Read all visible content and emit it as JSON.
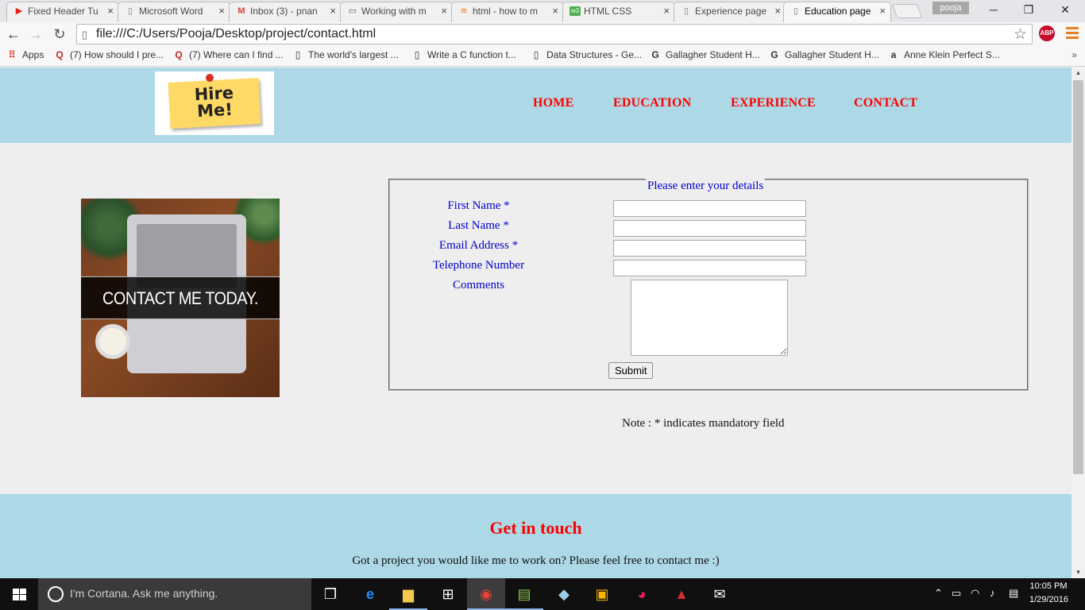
{
  "browser": {
    "tabs": [
      {
        "label": "Fixed Header Tu",
        "icon": "youtube-icon",
        "color": "#e62117"
      },
      {
        "label": "Microsoft Word",
        "icon": "page-icon",
        "color": "#777777"
      },
      {
        "label": "Inbox (3) - pnan",
        "icon": "gmail-icon",
        "color": "#d44638"
      },
      {
        "label": "Working with m",
        "icon": "monitor-icon",
        "color": "#555555"
      },
      {
        "label": "html - how to m",
        "icon": "stackoverflow-icon",
        "color": "#f48024"
      },
      {
        "label": "HTML CSS",
        "icon": "w3schools-icon",
        "color": "#4caf50"
      },
      {
        "label": "Experience page",
        "icon": "page-icon",
        "color": "#777777"
      },
      {
        "label": "Education page",
        "icon": "page-icon",
        "color": "#777777"
      }
    ],
    "profile_name": "pooja",
    "window_controls": {
      "minimize": "─",
      "maximize": "❐",
      "close": "✕"
    },
    "address": {
      "url": "file:///C:/Users/Pooja/Desktop/project/contact.html"
    },
    "extension_badge": "ABP",
    "bookmarks": [
      {
        "label": "Apps",
        "icon": "apps-icon"
      },
      {
        "label": "(7) How should I pre...",
        "icon": "quora-icon"
      },
      {
        "label": "(7) Where can I find ...",
        "icon": "quora-icon"
      },
      {
        "label": "The world's largest ...",
        "icon": "page-icon"
      },
      {
        "label": "Write a C function t...",
        "icon": "page-icon"
      },
      {
        "label": "Data Structures - Ge...",
        "icon": "page-icon"
      },
      {
        "label": "Gallagher Student H...",
        "icon": "gallagher-icon"
      },
      {
        "label": "Gallagher Student H...",
        "icon": "gallagher-icon"
      },
      {
        "label": "Anne Klein Perfect S...",
        "icon": "amazon-icon"
      }
    ],
    "bookmarks_more": "»"
  },
  "site": {
    "logo_text_line1": "Hire",
    "logo_text_line2": "Me!",
    "nav": [
      "HOME",
      "EDUCATION",
      "EXPERIENCE",
      "CONTACT"
    ],
    "hero_image_text": "CONTACT ME TODAY.",
    "form": {
      "legend": "Please enter your details",
      "fields": [
        {
          "label": "First Name *",
          "value": ""
        },
        {
          "label": "Last Name *",
          "value": ""
        },
        {
          "label": "Email Address *",
          "value": ""
        },
        {
          "label": "Telephone Number",
          "value": ""
        }
      ],
      "comments_label": "Comments",
      "comments_value": "",
      "submit_label": "Submit"
    },
    "note": "Note : * indicates mandatory field",
    "footer": {
      "title": "Get in touch",
      "text": "Got a project you would like me to work on? Please feel free to contact me :)"
    },
    "colors": {
      "header_bg": "#add8e6",
      "nav_color": "#ff0000",
      "label_color": "#0000cc",
      "page_bg": "#eeeeee"
    }
  },
  "taskbar": {
    "search_placeholder": "I'm Cortana. Ask me anything.",
    "apps": [
      "task-view-icon",
      "edge-icon",
      "file-explorer-icon",
      "store-icon",
      "chrome-icon",
      "sheets-icon",
      "app-icon",
      "photos-icon",
      "paint-icon",
      "acrobat-icon",
      "mail-icon"
    ],
    "time": "10:05 PM",
    "date": "1/29/2016"
  }
}
